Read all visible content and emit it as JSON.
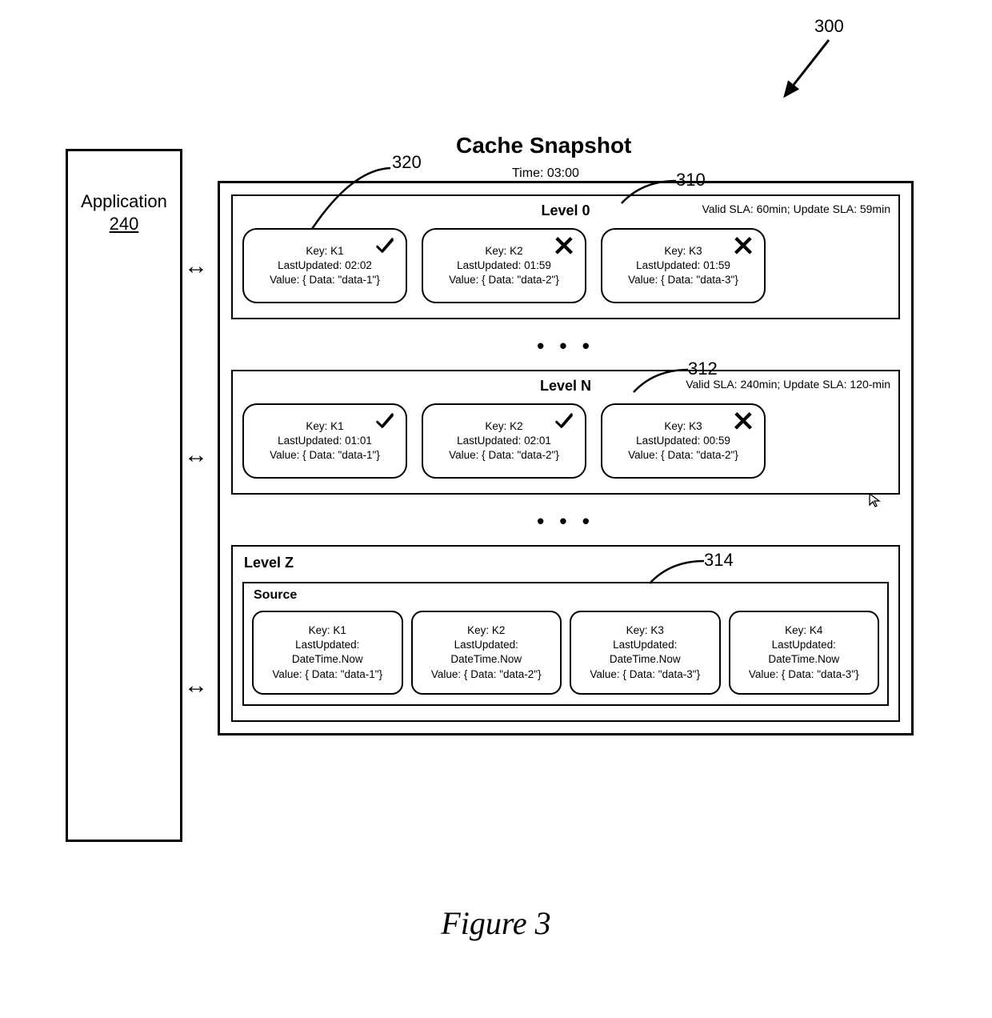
{
  "figure": {
    "id": "300",
    "caption": "Figure 3"
  },
  "application": {
    "title": "Application",
    "ref": "240"
  },
  "snapshot": {
    "title": "Cache Snapshot",
    "time_label": "Time: 03:00"
  },
  "callouts": {
    "c310": "310",
    "c312": "312",
    "c314": "314",
    "c320": "320"
  },
  "levels": [
    {
      "name": "Level 0",
      "sla": "Valid SLA: 60min; Update SLA: 59min",
      "cards": [
        {
          "key": "Key: K1",
          "upd": "LastUpdated: 02:02",
          "val": "Value: { Data: \"data-1\"}",
          "status": "valid"
        },
        {
          "key": "Key: K2",
          "upd": "LastUpdated: 01:59",
          "val": "Value: { Data: \"data-2\"}",
          "status": "invalid"
        },
        {
          "key": "Key: K3",
          "upd": "LastUpdated: 01:59",
          "val": "Value: { Data: \"data-3\"}",
          "status": "invalid"
        }
      ]
    },
    {
      "name": "Level N",
      "sla": "Valid SLA: 240min; Update SLA: 120-min",
      "cards": [
        {
          "key": "Key: K1",
          "upd": "LastUpdated: 01:01",
          "val": "Value: { Data: \"data-1\"}",
          "status": "valid"
        },
        {
          "key": "Key: K2",
          "upd": "LastUpdated: 02:01",
          "val": "Value: { Data: \"data-2\"}",
          "status": "valid"
        },
        {
          "key": "Key: K3",
          "upd": "LastUpdated: 00:59",
          "val": "Value: { Data: \"data-2\"}",
          "status": "invalid"
        }
      ]
    }
  ],
  "levelZ": {
    "name": "Level Z",
    "source_label": "Source",
    "cards": [
      {
        "key": "Key: K1",
        "upd": "LastUpdated: DateTime.Now",
        "val": "Value: { Data: \"data-1\"}"
      },
      {
        "key": "Key: K2",
        "upd": "LastUpdated: DateTime.Now",
        "val": "Value: { Data: \"data-2\"}"
      },
      {
        "key": "Key: K3",
        "upd": "LastUpdated: DateTime.Now",
        "val": "Value: { Data: \"data-3\"}"
      },
      {
        "key": "Key: K4",
        "upd": "LastUpdated: DateTime.Now",
        "val": "Value: { Data: \"data-3\"}"
      }
    ]
  }
}
